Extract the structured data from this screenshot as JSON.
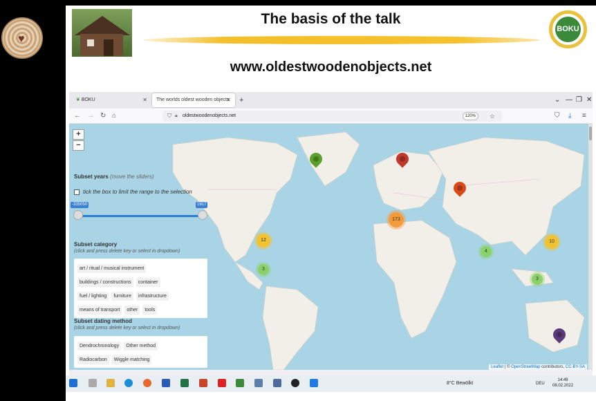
{
  "slide": {
    "title": "The basis of the talk",
    "url": "www.oldestwoodenobjects.net",
    "logo_text": "BOKU"
  },
  "browser": {
    "tabs": [
      {
        "label": "BOKU",
        "active": false
      },
      {
        "label": "The worlds oldest wooden objects",
        "active": true
      }
    ],
    "address": "oldestwoodenobjects.net",
    "zoom": "120%"
  },
  "map": {
    "zoom_in": "+",
    "zoom_out": "−",
    "subset_years": {
      "heading": "Subset years",
      "hint": "(move the sliders)",
      "checkbox_label": "tick the box to limit the range to the selection",
      "min_value": "-335050",
      "max_value": "1917"
    },
    "subset_category": {
      "heading": "Subset category",
      "hint": "(click and press delete key or select in dropdown)",
      "chips": [
        "art / ritual / musical instrument",
        "buildings / constructions",
        "container",
        "fuel / lighting",
        "furniture",
        "infrastructure",
        "means of transport",
        "other",
        "tools"
      ]
    },
    "subset_dating": {
      "heading": "Subset dating method",
      "hint": "(click and press delete key or select in dropdown)",
      "chips": [
        "Dendrochronology",
        "Other method",
        "Radiocarbon",
        "Wiggle matching"
      ]
    },
    "clusters": [
      {
        "label": "12",
        "color": "#f1c232"
      },
      {
        "label": "3",
        "color": "#8bd16a"
      },
      {
        "label": "173",
        "color": "#f39a3a"
      },
      {
        "label": "4",
        "color": "#8bd16a"
      },
      {
        "label": "10",
        "color": "#f1c232"
      },
      {
        "label": "3",
        "color": "#8bd16a"
      }
    ],
    "markers": [
      {
        "name": "green",
        "color": "#5aa02c"
      },
      {
        "name": "red",
        "color": "#c0392b"
      },
      {
        "name": "red",
        "color": "#d84a1b"
      },
      {
        "name": "purple",
        "color": "#5b3a7a"
      }
    ],
    "attribution": {
      "leaflet": "Leaflet",
      "sep": " | © ",
      "osm": "OpenStreetMap",
      "contrib": " contributors, ",
      "license": "CC-BY-SA"
    }
  },
  "taskbar": {
    "weather": "8°C  Bewölkt",
    "language": "DEU",
    "time": "14:49",
    "date": "08.02.2022"
  }
}
